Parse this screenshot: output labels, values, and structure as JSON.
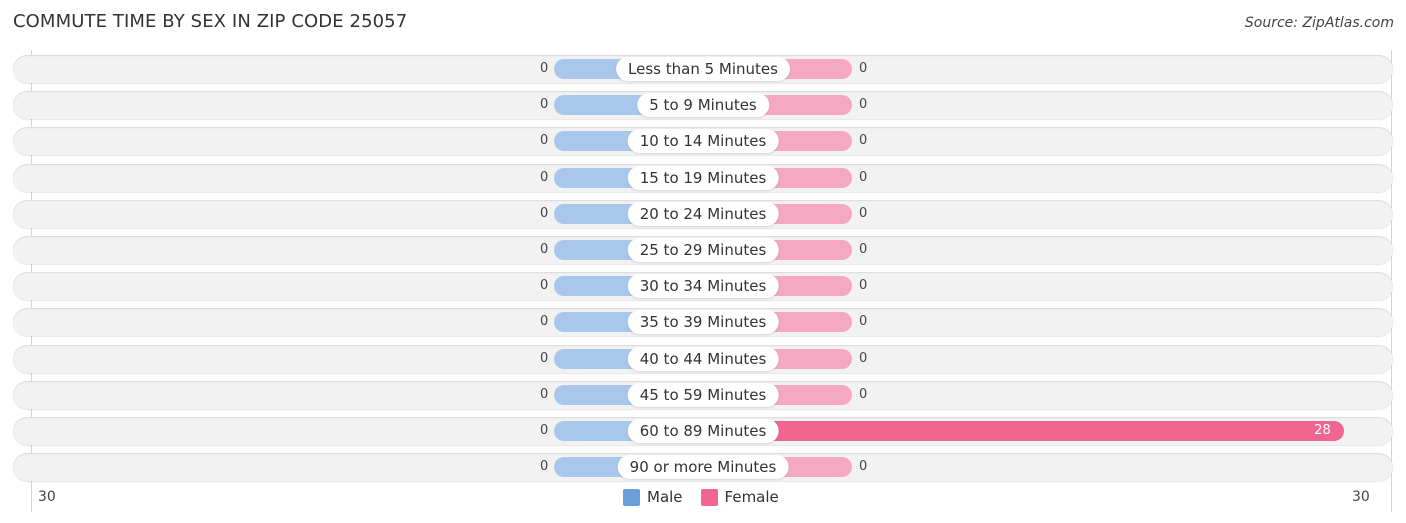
{
  "title": "COMMUTE TIME BY SEX IN ZIP CODE 25057",
  "source": "Source: ZipAtlas.com",
  "colors": {
    "male": "#a9c7eb",
    "male_legend": "#6a9fdc",
    "female": "#f5a8c1",
    "female_strong": "#f06690",
    "female_legend": "#f06690"
  },
  "chart_data": {
    "type": "bar",
    "orientation": "horizontal-diverging",
    "title": "COMMUTE TIME BY SEX IN ZIP CODE 25057",
    "categories": [
      "Less than 5 Minutes",
      "5 to 9 Minutes",
      "10 to 14 Minutes",
      "15 to 19 Minutes",
      "20 to 24 Minutes",
      "25 to 29 Minutes",
      "30 to 34 Minutes",
      "35 to 39 Minutes",
      "40 to 44 Minutes",
      "45 to 59 Minutes",
      "60 to 89 Minutes",
      "90 or more Minutes"
    ],
    "series": [
      {
        "name": "Male",
        "values": [
          0,
          0,
          0,
          0,
          0,
          0,
          0,
          0,
          0,
          0,
          0,
          0
        ]
      },
      {
        "name": "Female",
        "values": [
          0,
          0,
          0,
          0,
          0,
          0,
          0,
          0,
          0,
          0,
          28,
          0
        ]
      }
    ],
    "xlim": [
      -30,
      30
    ],
    "axis_ticks": {
      "left": "30",
      "right": "30"
    },
    "legend": {
      "position": "bottom-center",
      "entries": [
        "Male",
        "Female"
      ]
    },
    "xlabel": "",
    "ylabel": ""
  }
}
